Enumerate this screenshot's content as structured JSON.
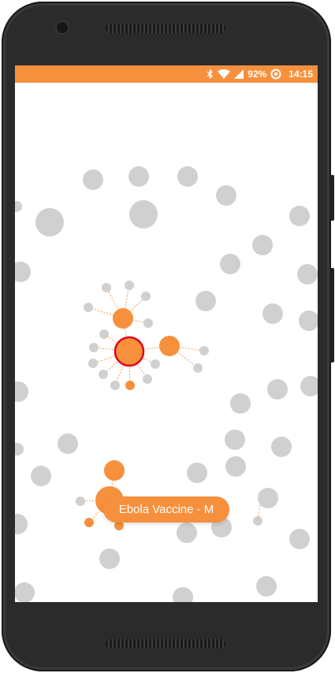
{
  "status_bar": {
    "battery_percent": "92%",
    "time": "14:15",
    "icons": [
      "bluetooth-icon",
      "wifi-icon",
      "signal-icon",
      "battery-icon"
    ]
  },
  "graph": {
    "selected_label": "Ebola Vaccine - M",
    "colors": {
      "accent": "#f6903d",
      "inactive_node": "#d0d0d0",
      "selected_ring": "#e0001b"
    }
  }
}
